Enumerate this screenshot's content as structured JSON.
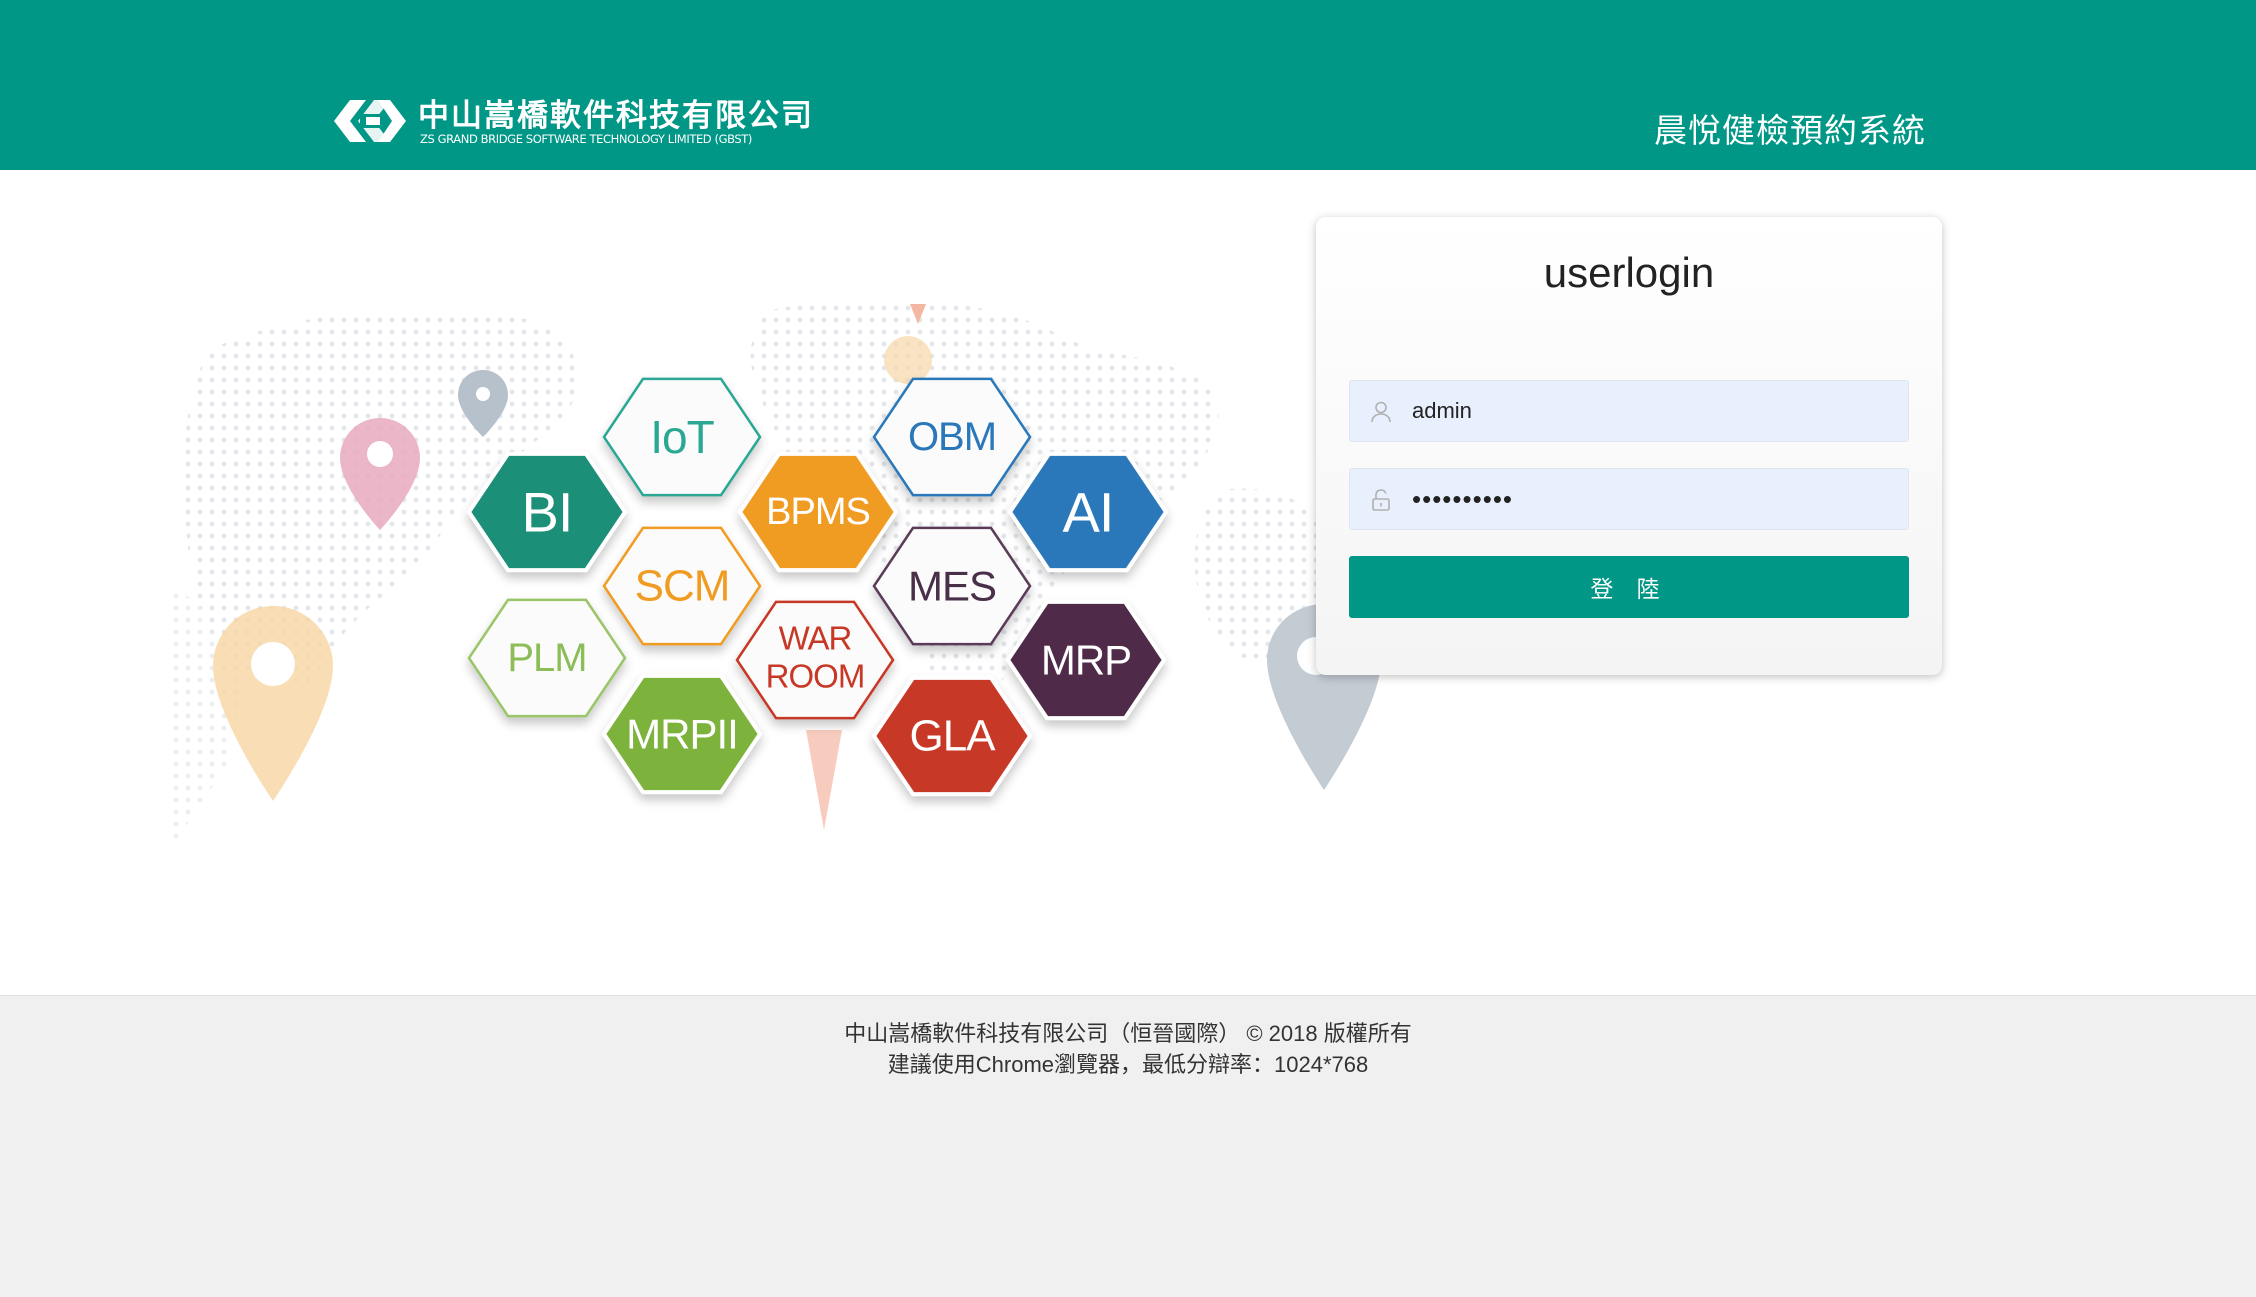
{
  "header": {
    "logo_cn": "中山嵩橋軟件科技有限公司",
    "logo_en": "ZS GRAND BRIDGE SOFTWARE TECHNOLOGY LIMITED (GBST)",
    "system_title": "晨悅健檢預約系統",
    "background_color": "#009787"
  },
  "illustration": {
    "hexagons": [
      {
        "label": "IoT",
        "color": "teal-outline"
      },
      {
        "label": "OBM",
        "color": "blue-outline"
      },
      {
        "label": "BI",
        "color": "#1f8f78"
      },
      {
        "label": "BPMS",
        "color": "#f09c22"
      },
      {
        "label": "AI",
        "color": "#2a78b9"
      },
      {
        "label": "SCM",
        "color": "orange-outline"
      },
      {
        "label": "MES",
        "color": "purple-outline"
      },
      {
        "label": "PLM",
        "color": "green-outline"
      },
      {
        "label": "WAR",
        "color": "red-outline"
      },
      {
        "label": "ROOM",
        "color": "red-outline"
      },
      {
        "label": "MRP",
        "color": "#4f2a48"
      },
      {
        "label": "MRPII",
        "color": "#7db33d"
      },
      {
        "label": "GLA",
        "color": "#c83826"
      }
    ]
  },
  "login": {
    "title": "userlogin",
    "username_value": "admin",
    "password_value": "••••••••••",
    "submit_label": "登 陸",
    "user_icon": "user-icon",
    "lock_icon": "lock-icon"
  },
  "footer": {
    "copyright": "中山嵩橋軟件科技有限公司（恒晉國際） © 2018 版權所有",
    "browser_note": "建議使用Chrome瀏覽器，最低分辯率：1024*768"
  }
}
